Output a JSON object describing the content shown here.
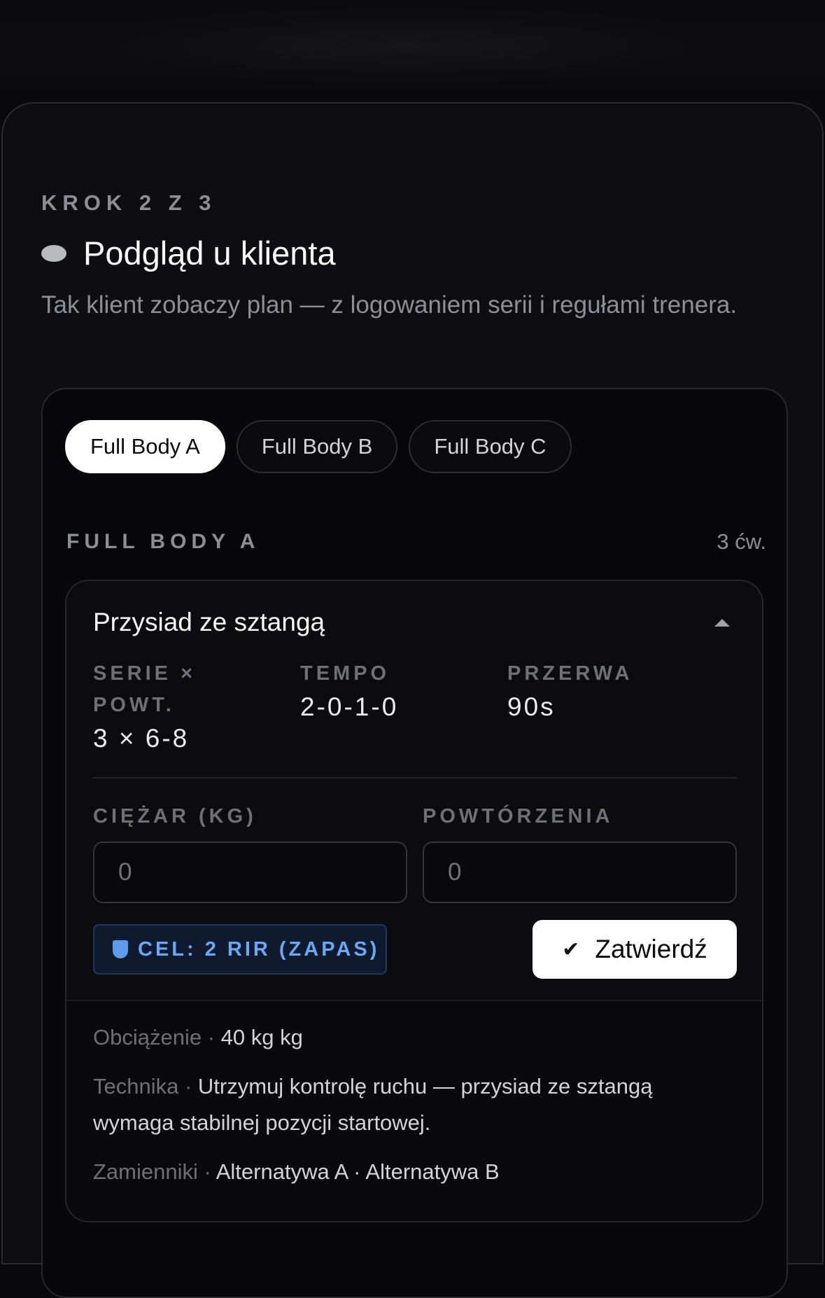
{
  "step": {
    "label": "KROK 2 Z 3"
  },
  "header": {
    "title": "Podgląd u klienta",
    "subtitle": "Tak klient zobaczy plan — z logowaniem serii i regułami trenera."
  },
  "tabs": [
    {
      "label": "Full Body A",
      "active": true
    },
    {
      "label": "Full Body B",
      "active": false
    },
    {
      "label": "Full Body C",
      "active": false
    }
  ],
  "day": {
    "title": "FULL BODY A",
    "count": "3 ćw."
  },
  "exercise": {
    "name": "Przysiad ze sztangą",
    "stats": [
      {
        "label": "SERIE × POWT.",
        "value": "3 × 6-8"
      },
      {
        "label": "TEMPO",
        "value": "2-0-1-0"
      },
      {
        "label": "PRZERWA",
        "value": "90s"
      }
    ],
    "fields": {
      "weight_label": "CIĘŻAR (KG)",
      "weight_placeholder": "0",
      "reps_label": "POWTÓRZENIA",
      "reps_placeholder": "0"
    },
    "target_badge": "CEL: 2 RIR (ZAPAS)",
    "confirm_label": "Zatwierdź",
    "details": [
      {
        "key": "Obciążenie",
        "value": "40 kg kg"
      },
      {
        "key": "Technika",
        "value": "Utrzymuj kontrolę ruchu — przysiad ze sztangą wymaga stabilnej pozycji startowej."
      },
      {
        "key": "Zamienniki",
        "value": "Alternatywa A · Alternatywa B"
      }
    ]
  },
  "colors": {
    "background": "#09090b",
    "accent_blue": "#6aa8f5",
    "primary_button": "#ffffff"
  },
  "icons": {
    "title": "eye-icon",
    "collapse": "chevron-up-icon",
    "badge": "shield-icon",
    "confirm": "check-icon"
  }
}
